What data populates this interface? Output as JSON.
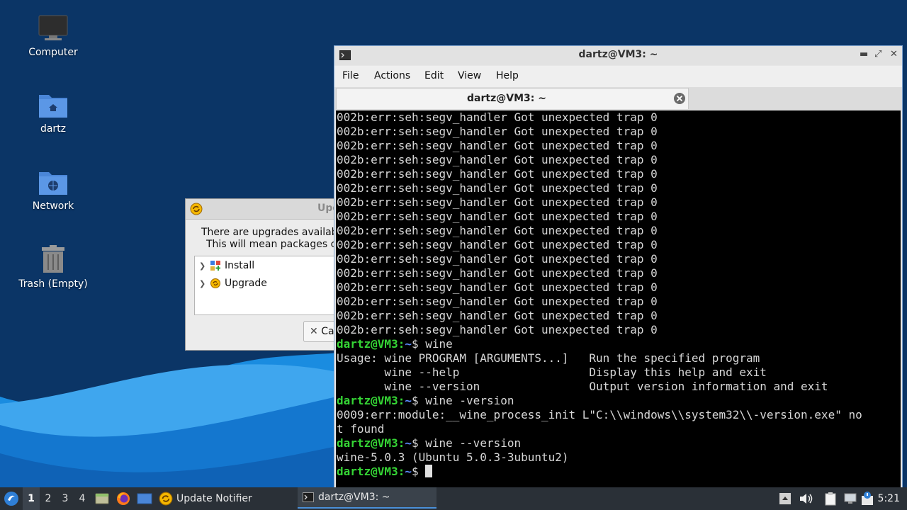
{
  "desktop": {
    "icons": [
      {
        "label": "Computer",
        "icon": "computer-icon"
      },
      {
        "label": "dartz",
        "icon": "home-folder-icon"
      },
      {
        "label": "Network",
        "icon": "network-folder-icon"
      },
      {
        "label": "Trash (Empty)",
        "icon": "trash-icon"
      }
    ]
  },
  "update_dialog": {
    "title": "Upd",
    "message_line1": "There are upgrades availabl",
    "message_line2": "This will mean packages co",
    "tree": [
      {
        "label": "Install",
        "icon": "install-icon"
      },
      {
        "label": "Upgrade",
        "icon": "upgrade-icon"
      }
    ],
    "cancel_label": "Ca"
  },
  "terminal": {
    "title": "dartz@VM3: ~",
    "menu": [
      "File",
      "Actions",
      "Edit",
      "View",
      "Help"
    ],
    "tab_label": "dartz@VM3: ~",
    "lines": [
      {
        "text": "002b:err:seh:segv_handler Got unexpected trap 0"
      },
      {
        "text": "002b:err:seh:segv_handler Got unexpected trap 0"
      },
      {
        "text": "002b:err:seh:segv_handler Got unexpected trap 0"
      },
      {
        "text": "002b:err:seh:segv_handler Got unexpected trap 0"
      },
      {
        "text": "002b:err:seh:segv_handler Got unexpected trap 0"
      },
      {
        "text": "002b:err:seh:segv_handler Got unexpected trap 0"
      },
      {
        "text": "002b:err:seh:segv_handler Got unexpected trap 0"
      },
      {
        "text": "002b:err:seh:segv_handler Got unexpected trap 0"
      },
      {
        "text": "002b:err:seh:segv_handler Got unexpected trap 0"
      },
      {
        "text": "002b:err:seh:segv_handler Got unexpected trap 0"
      },
      {
        "text": "002b:err:seh:segv_handler Got unexpected trap 0"
      },
      {
        "text": "002b:err:seh:segv_handler Got unexpected trap 0"
      },
      {
        "text": "002b:err:seh:segv_handler Got unexpected trap 0"
      },
      {
        "text": "002b:err:seh:segv_handler Got unexpected trap 0"
      },
      {
        "text": "002b:err:seh:segv_handler Got unexpected trap 0"
      },
      {
        "text": "002b:err:seh:segv_handler Got unexpected trap 0"
      },
      {
        "prompt": true,
        "user": "dartz@VM3",
        "path": "~",
        "cmd": "wine"
      },
      {
        "text": "Usage: wine PROGRAM [ARGUMENTS...]   Run the specified program"
      },
      {
        "text": "       wine --help                   Display this help and exit"
      },
      {
        "text": "       wine --version                Output version information and exit"
      },
      {
        "prompt": true,
        "user": "dartz@VM3",
        "path": "~",
        "cmd": "wine -version"
      },
      {
        "text": "0009:err:module:__wine_process_init L\"C:\\\\windows\\\\system32\\\\-version.exe\" no"
      },
      {
        "text": "t found"
      },
      {
        "prompt": true,
        "user": "dartz@VM3",
        "path": "~",
        "cmd": "wine --version"
      },
      {
        "text": "wine-5.0.3 (Ubuntu 5.0.3-3ubuntu2)"
      },
      {
        "prompt": true,
        "user": "dartz@VM3",
        "path": "~",
        "cmd": "",
        "cursor": true
      }
    ]
  },
  "taskbar": {
    "workspaces": [
      "1",
      "2",
      "3",
      "4"
    ],
    "active_workspace": "1",
    "tasks": [
      {
        "label": "Update Notifier",
        "icon": "update-notifier-icon"
      },
      {
        "label": "dartz@VM3: ~",
        "icon": "terminal-icon"
      }
    ],
    "clock": "5:21"
  },
  "colors": {
    "prompt_user": "#35d435",
    "prompt_path": "#5b8cff",
    "terminal_bg": "#000000",
    "wallpaper_bg": "#0b3566",
    "taskbar_bg": "#2a3037"
  }
}
